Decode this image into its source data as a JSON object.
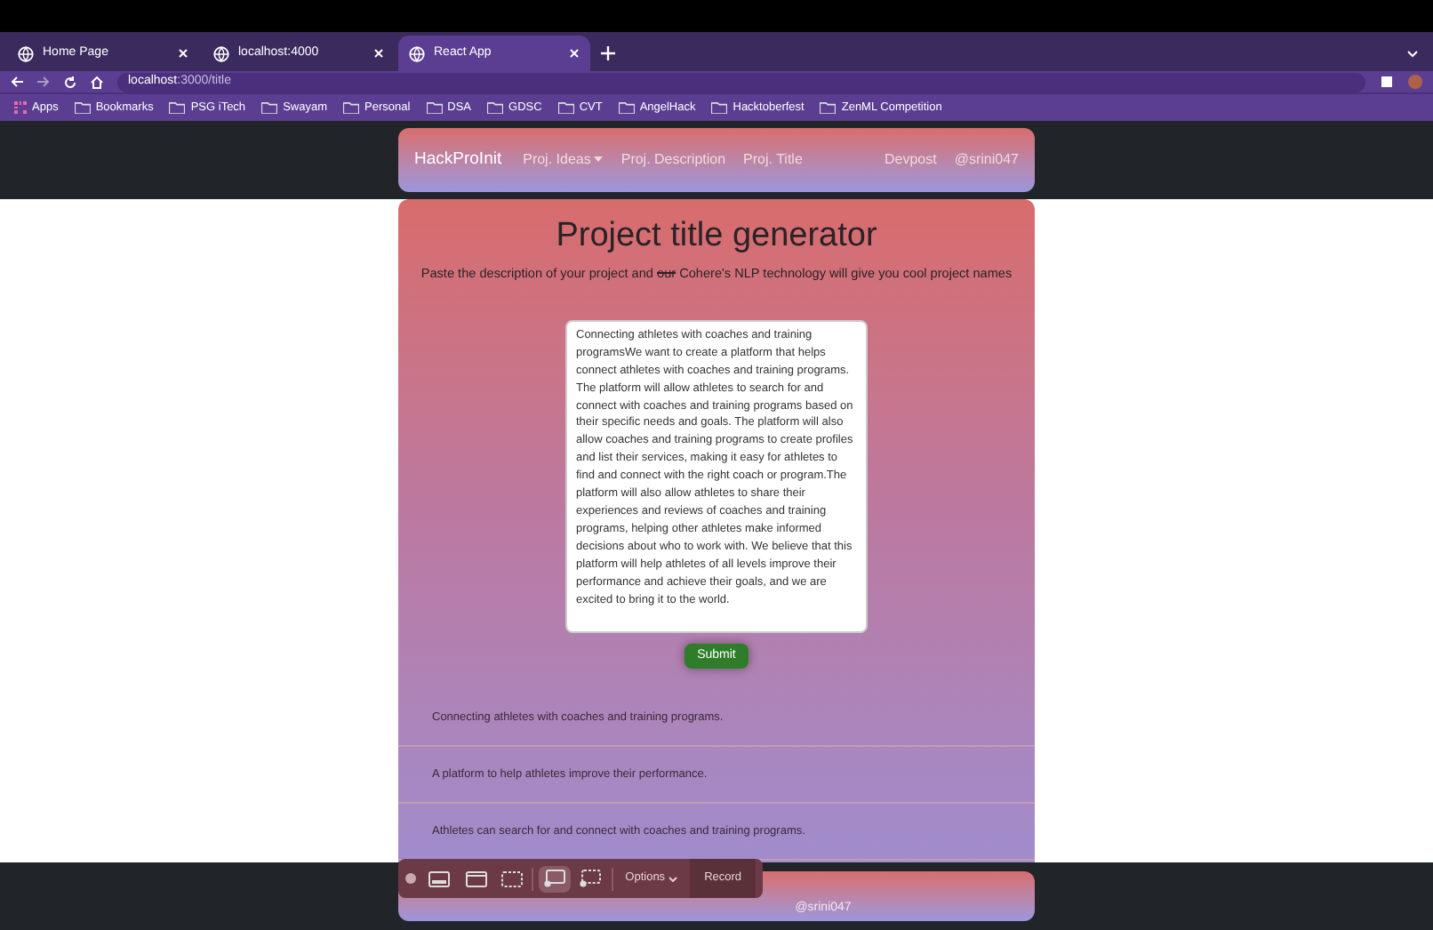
{
  "browser": {
    "tabs": [
      {
        "title": "Home Page",
        "selected": false
      },
      {
        "title": "localhost:4000",
        "selected": false
      },
      {
        "title": "React App",
        "selected": true
      }
    ],
    "address": {
      "host": "localhost",
      "path": ":3000/title"
    },
    "bookmarks": [
      "Apps",
      "Bookmarks",
      "PSG iTech",
      "Swayam",
      "Personal",
      "DSA",
      "GDSC",
      "CVT",
      "AngelHack",
      "Hacktoberfest",
      "ZenML Competition"
    ]
  },
  "navbar": {
    "brand": "HackProInit",
    "links": [
      {
        "label": "Proj. Ideas",
        "dropdown": true
      },
      {
        "label": "Proj. Description",
        "dropdown": false
      },
      {
        "label": "Proj. Title",
        "dropdown": false
      }
    ],
    "right_links": [
      "Devpost",
      "@srini047"
    ]
  },
  "main": {
    "title": "Project title generator",
    "subtitle_before": "Paste the description of your project and",
    "subtitle_struck": "our",
    "subtitle_after": "Cohere's NLP technology will give you cool project names",
    "description": "Connecting athletes with coaches and training programsWe want to create a platform that helps connect athletes with coaches and training programs. The platform will allow athletes to search for and connect with coaches and training programs based on their specific needs and goals. The platform will also allow coaches and training programs to create profiles and list their services, making it easy for athletes to find and connect with the right coach or program.The platform will also allow athletes to share their experiences and reviews of coaches and training programs, helping other athletes make informed decisions about who to work with. We believe that this platform will help athletes of all levels improve their performance and achieve their goals, and we are excited to bring it to the world.",
    "submit": "Submit",
    "results": [
      "Connecting athletes with coaches and training programs.",
      "A platform to help athletes improve their performance.",
      "Athletes can search for and connect with coaches and training programs."
    ]
  },
  "footer": {
    "handle": "@srini047"
  },
  "capture_toolbar": {
    "options": "Options",
    "record": "Record"
  }
}
